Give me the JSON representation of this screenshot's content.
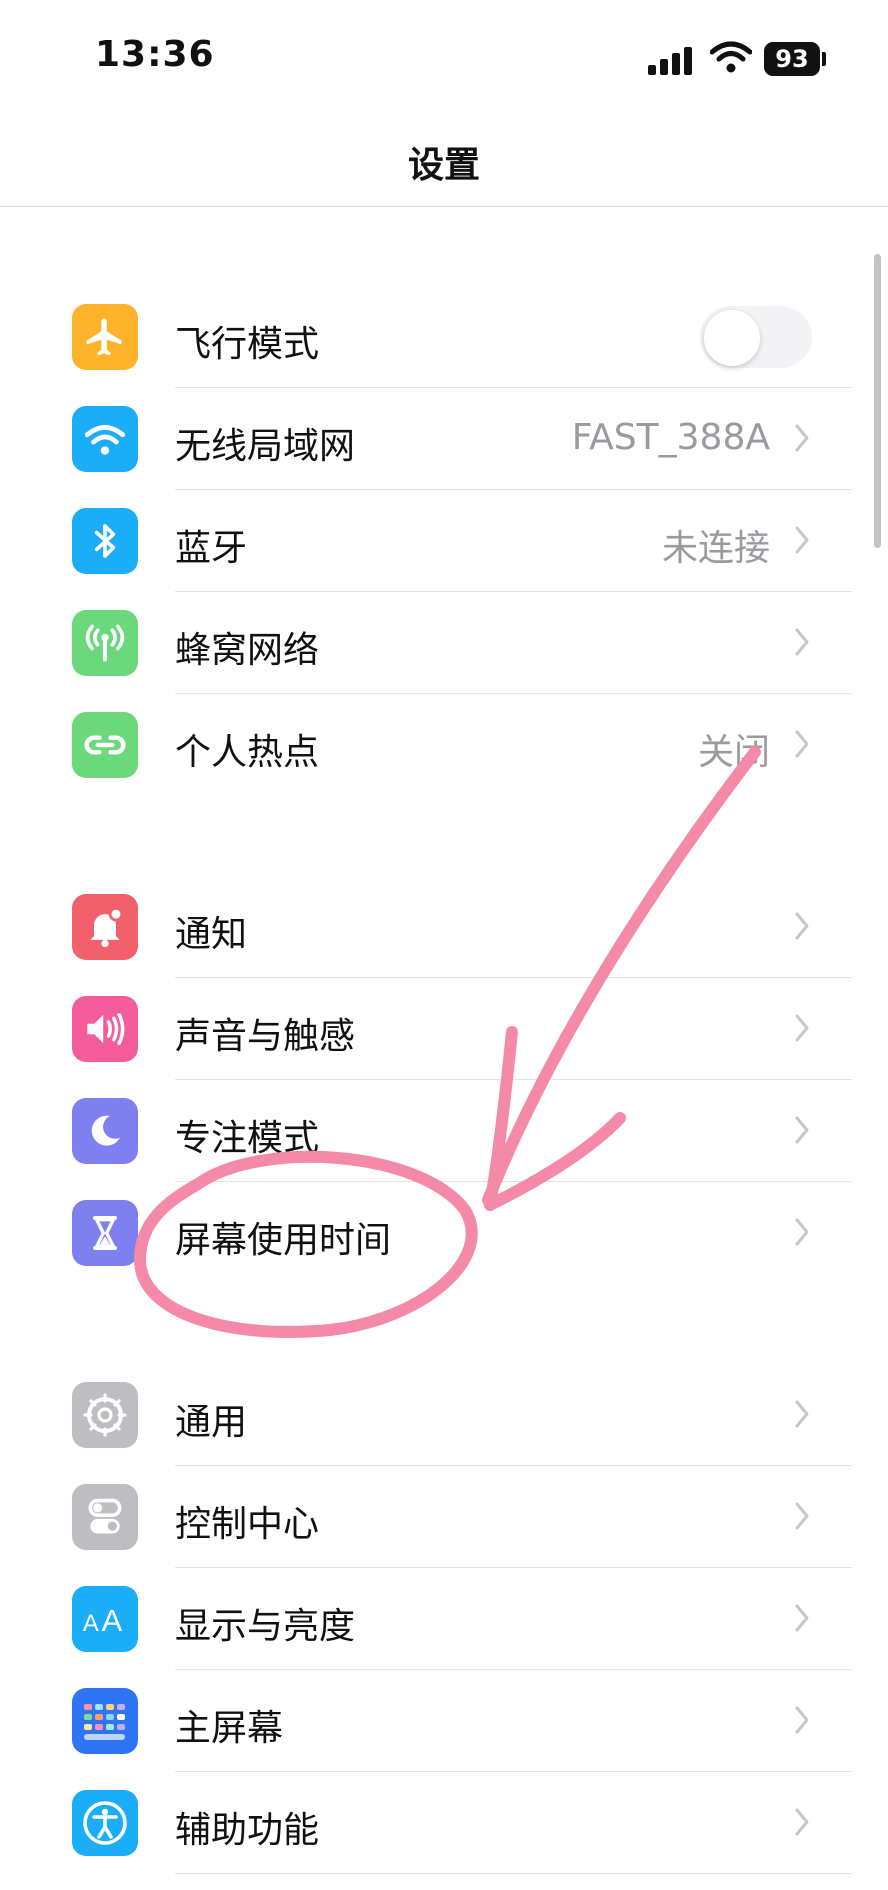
{
  "status_bar": {
    "time": "13:36",
    "battery": "93"
  },
  "nav": {
    "title": "设置"
  },
  "colors": {
    "airplane": "#FEB32A",
    "wifi": "#1BADF8",
    "bluetooth": "#1BADF8",
    "cellular": "#6BD87C",
    "hotspot": "#6BD87C",
    "notifications": "#F2606B",
    "sounds": "#F45C9C",
    "focus": "#7E80EF",
    "screen_time": "#7E80EF",
    "general": "#BDBDC2",
    "control_center": "#BDBDC2",
    "display": "#1BADF8",
    "home_screen": "#2F74F5",
    "accessibility": "#1BADF8",
    "annotation": "#F58AA8"
  },
  "groups": [
    {
      "items": [
        {
          "label": "飞行模式",
          "icon": "airplane-icon",
          "control": "toggle",
          "toggle_on": false
        },
        {
          "label": "无线局域网",
          "icon": "wifi-icon",
          "value": "FAST_388A"
        },
        {
          "label": "蓝牙",
          "icon": "bluetooth-icon",
          "value": "未连接"
        },
        {
          "label": "蜂窝网络",
          "icon": "cellular-icon"
        },
        {
          "label": "个人热点",
          "icon": "hotspot-icon",
          "value": "关闭"
        }
      ]
    },
    {
      "items": [
        {
          "label": "通知",
          "icon": "bell-icon"
        },
        {
          "label": "声音与触感",
          "icon": "speaker-icon"
        },
        {
          "label": "专注模式",
          "icon": "moon-icon"
        },
        {
          "label": "屏幕使用时间",
          "icon": "hourglass-icon"
        }
      ]
    },
    {
      "items": [
        {
          "label": "通用",
          "icon": "gear-icon"
        },
        {
          "label": "控制中心",
          "icon": "switches-icon"
        },
        {
          "label": "显示与亮度",
          "icon": "text-size-icon"
        },
        {
          "label": "主屏幕",
          "icon": "home-grid-icon"
        },
        {
          "label": "辅助功能",
          "icon": "accessibility-icon"
        }
      ]
    }
  ]
}
